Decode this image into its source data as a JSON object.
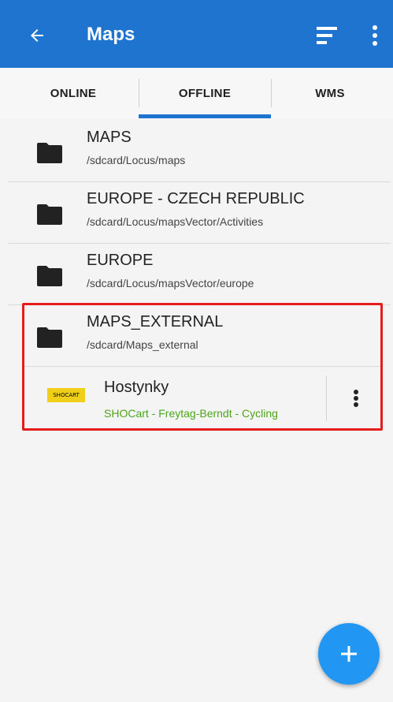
{
  "appbar": {
    "title": "Maps",
    "back_icon": "arrow-left-icon",
    "filter_icon": "sort-filter-icon",
    "more_icon": "more-vert-icon",
    "color": "#1f74cf"
  },
  "tabs": [
    {
      "label": "ONLINE",
      "selected": false
    },
    {
      "label": "OFFLINE",
      "selected": true
    },
    {
      "label": "WMS",
      "selected": false
    }
  ],
  "folders": [
    {
      "name": "MAPS",
      "path": "/sdcard/Locus/maps"
    },
    {
      "name": "EUROPE - CZECH REPUBLIC",
      "path": "/sdcard/Locus/mapsVector/Activities"
    },
    {
      "name": "EUROPE",
      "path": "/sdcard/Locus/mapsVector/europe"
    },
    {
      "name": "MAPS_EXTERNAL",
      "path": "/sdcard/Maps_external"
    }
  ],
  "map_item": {
    "thumbnail_text": "SHOCART",
    "name": "Hostynky",
    "description": "SHOCart - Freytag-Berndt - Cycling",
    "description_color": "#4ca517",
    "menu_icon": "more-vert-icon"
  },
  "highlight_color": "#e51c1c",
  "fab": {
    "icon": "plus-icon",
    "color": "#2196f3"
  }
}
